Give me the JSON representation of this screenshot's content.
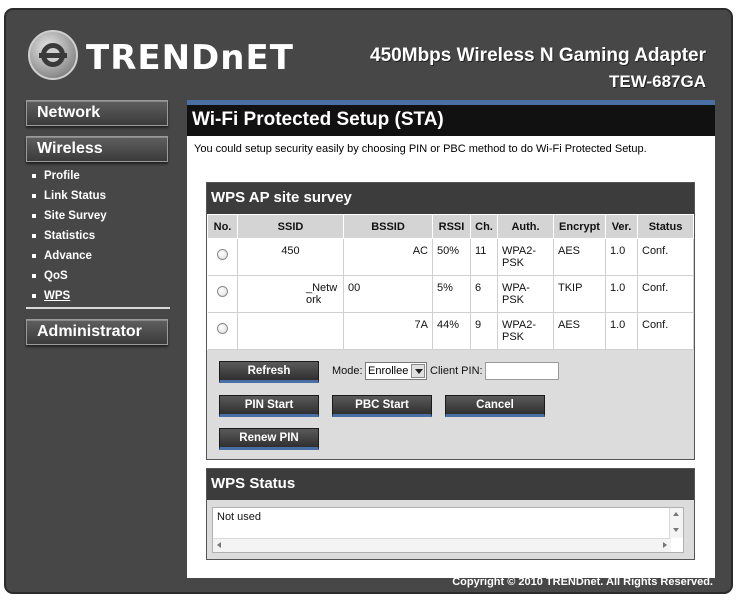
{
  "header": {
    "brand": "TRENDnET",
    "product": "450Mbps Wireless N Gaming Adapter",
    "model": "TEW-687GA"
  },
  "sidebar": {
    "network": "Network",
    "wireless": "Wireless",
    "items": [
      "Profile",
      "Link Status",
      "Site Survey",
      "Statistics",
      "Advance",
      "QoS",
      "WPS"
    ],
    "active": "WPS",
    "administrator": "Administrator"
  },
  "page": {
    "title": "Wi-Fi Protected Setup (STA)",
    "intro": "You could setup security easily by choosing PIN or PBC method to do Wi-Fi Protected Setup."
  },
  "survey": {
    "title": "WPS AP site survey",
    "columns": [
      "No.",
      "SSID",
      "BSSID",
      "RSSI",
      "Ch.",
      "Auth.",
      "Encrypt",
      "Ver.",
      "Status"
    ],
    "rows": [
      {
        "ssid": "450",
        "bssid": "AC",
        "rssi": "50%",
        "ch": "11",
        "auth": "WPA2-PSK",
        "encrypt": "AES",
        "ver": "1.0",
        "status": "Conf."
      },
      {
        "ssid": "_Network",
        "bssid": "00",
        "rssi": "5%",
        "ch": "6",
        "auth": "WPA-PSK",
        "encrypt": "TKIP",
        "ver": "1.0",
        "status": "Conf."
      },
      {
        "ssid": "",
        "bssid": "7A",
        "rssi": "44%",
        "ch": "9",
        "auth": "WPA2-PSK",
        "encrypt": "AES",
        "ver": "1.0",
        "status": "Conf."
      }
    ],
    "refresh": "Refresh",
    "mode_label": "Mode:",
    "mode_value": "Enrollee",
    "client_pin_label": "Client PIN:",
    "client_pin_value": "",
    "pin_start": "PIN Start",
    "pbc_start": "PBC Start",
    "cancel": "Cancel",
    "renew_pin": "Renew PIN"
  },
  "status": {
    "title": "WPS Status",
    "text": "Not used"
  },
  "footer": "Copyright © 2010 TRENDnet. All Rights Reserved.",
  "colors": {
    "frame": "#474747",
    "accent_blue": "#4a6fa5",
    "panel_header": "#3c3c3c"
  }
}
